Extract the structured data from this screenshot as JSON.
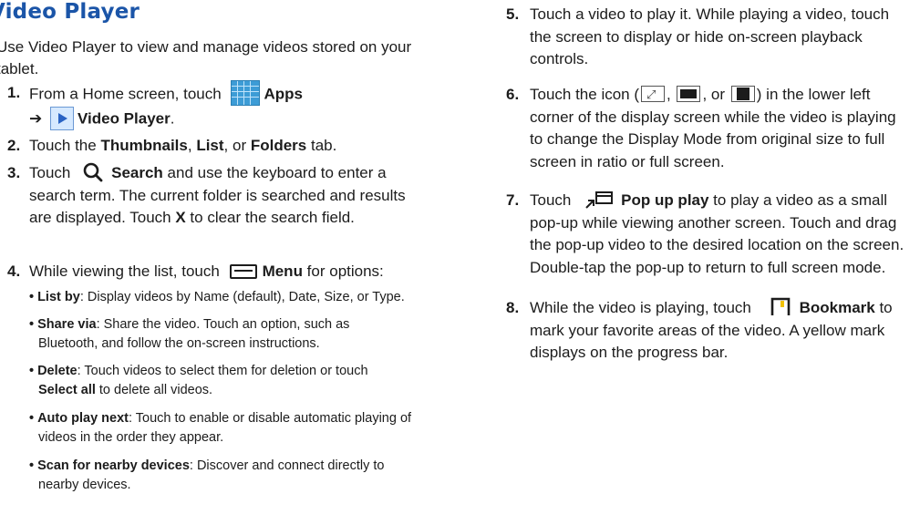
{
  "title": "Video Player",
  "intro": "Use Video Player to view and manage videos stored on your tablet.",
  "steps_left": [
    {
      "num": "1.",
      "a": "From a Home screen, touch",
      "apps": "Apps",
      "arrow": "➔",
      "vp": "Video Player",
      "end": "."
    },
    {
      "num": "2.",
      "a": "Touch the ",
      "b1": "Thumbnails",
      "c": ", ",
      "b2": "List",
      "d": ", or ",
      "b3": "Folders",
      "e": " tab."
    },
    {
      "num": "3.",
      "a": "Touch",
      "search": "Search",
      "b": " and use the keyboard to enter a",
      "line2": "search term. The current folder is searched and results",
      "line3a": "are displayed. Touch ",
      "x": "X",
      "line3b": " to clear the search field."
    },
    {
      "num": "4.",
      "a": "While viewing the list, touch",
      "menu": "Menu",
      "b": " for options:"
    }
  ],
  "bullets": [
    {
      "dot": "•",
      "label": "List by",
      "text": ": Display videos by Name (default), Date, Size, or Type."
    },
    {
      "dot": "•",
      "label": "Share via",
      "text": ": Share the video. Touch an option, such as",
      "line2": "Bluetooth, and follow the on-screen instructions."
    },
    {
      "dot": "•",
      "label": "Delete",
      "text": ": Touch videos to select them for deletion or touch",
      "line2b": "Select all",
      "line2": " to delete all videos."
    },
    {
      "dot": "•",
      "label": "Auto play next",
      "text": ": Touch to enable or disable automatic playing of",
      "line2": "videos in the order they appear."
    },
    {
      "dot": "•",
      "label": "Scan for nearby devices",
      "text": ": Discover and connect directly to",
      "line2": "nearby devices."
    }
  ],
  "steps_right": [
    {
      "num": "5.",
      "l1": "Touch a video to play it. While playing a video, touch",
      "l2": "the screen to display or hide on-screen playback",
      "l3": "controls."
    },
    {
      "num": "6.",
      "l1a": "Touch the icon (",
      "sep1": ",",
      "sep2": ", or",
      "l1b": ") in the lower left",
      "l2": "corner of the display screen while the video is playing",
      "l3": "to change the Display Mode from original size to full",
      "l4": "screen in ratio or full screen."
    },
    {
      "num": "7.",
      "a": "Touch",
      "popup": "Pop up play",
      "b": " to play a video as a small",
      "l2": "pop-up while viewing another screen. Touch and drag",
      "l3": "the pop-up video to the desired location on the screen.",
      "l4": "Double-tap the pop-up to return to full screen mode."
    },
    {
      "num": "8.",
      "a": "While the video is playing, touch",
      "bookmark": "Bookmark",
      "b": " to",
      "l2": "mark your favorite areas of the video. A yellow mark",
      "l3": "displays on the progress bar."
    }
  ]
}
